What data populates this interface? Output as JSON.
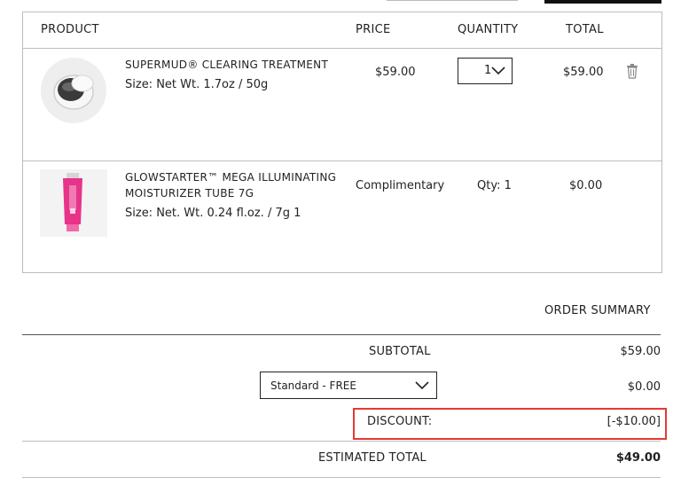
{
  "cart": {
    "headers": {
      "product": "PRODUCT",
      "price": "PRICE",
      "quantity": "QUANTITY",
      "total": "TOTAL"
    },
    "items": [
      {
        "name": "SUPERMUD® CLEARING TREATMENT",
        "size": "Size: Net Wt. 1.7oz / 50g",
        "price": "$59.00",
        "quantity": "1",
        "total": "$59.00",
        "image_icon": "jar-icon"
      },
      {
        "name_line1": "GLOWSTARTER™ MEGA ILLUMINATING",
        "name_line2": "MOISTURIZER TUBE 7G",
        "size": "Size: Net. Wt. 0.24 fl.oz. / 7g 1",
        "price": "Complimentary",
        "quantity": "Qty: 1",
        "total": "$0.00",
        "image_icon": "tube-icon"
      }
    ]
  },
  "summary": {
    "title": "ORDER SUMMARY",
    "subtotal_label": "SUBTOTAL",
    "subtotal_value": "$59.00",
    "shipping_option": "Standard - FREE",
    "shipping_value": "$0.00",
    "discount_label": "DISCOUNT:",
    "discount_value": "[-$10.00]",
    "estimated_label": "ESTIMATED TOTAL",
    "estimated_value": "$49.00"
  },
  "colors": {
    "highlight": "#e53935",
    "tube_pink": "#e8338a"
  }
}
